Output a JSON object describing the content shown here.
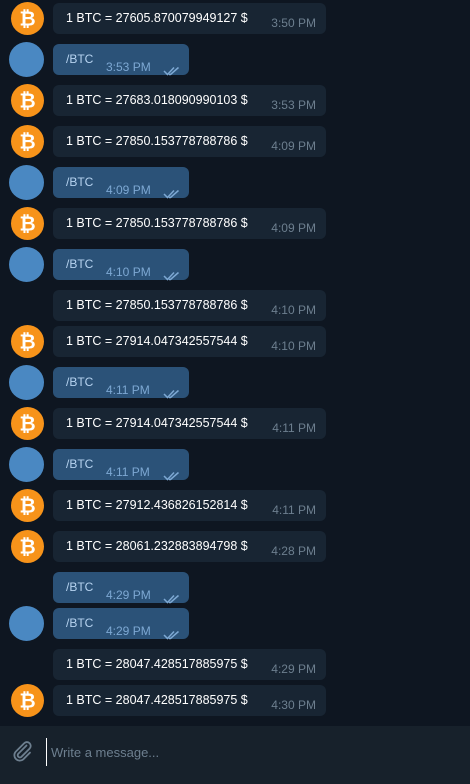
{
  "messages": [
    {
      "side": "in",
      "avatar": true,
      "text": "1 BTC = 27605.870079949127 $",
      "time": "3:50 PM"
    },
    {
      "side": "out",
      "avatar": true,
      "text": "/BTC",
      "time": "3:53 PM"
    },
    {
      "side": "in",
      "avatar": true,
      "text": "1 BTC = 27683.018090990103 $",
      "time": "3:53 PM"
    },
    {
      "side": "in",
      "avatar": true,
      "text": "1 BTC = 27850.153778788786 $",
      "time": "4:09 PM"
    },
    {
      "side": "out",
      "avatar": true,
      "text": "/BTC",
      "time": "4:09 PM"
    },
    {
      "side": "in",
      "avatar": true,
      "text": "1 BTC = 27850.153778788786 $",
      "time": "4:09 PM"
    },
    {
      "side": "out",
      "avatar": true,
      "text": "/BTC",
      "time": "4:10 PM"
    },
    {
      "side": "in",
      "avatar": false,
      "text": "1 BTC = 27850.153778788786 $",
      "time": "4:10 PM"
    },
    {
      "side": "in",
      "avatar": true,
      "text": "1 BTC = 27914.047342557544 $",
      "time": "4:10 PM"
    },
    {
      "side": "out",
      "avatar": true,
      "text": "/BTC",
      "time": "4:11 PM"
    },
    {
      "side": "in",
      "avatar": true,
      "text": "1 BTC = 27914.047342557544 $",
      "time": "4:11 PM"
    },
    {
      "side": "out",
      "avatar": true,
      "text": "/BTC",
      "time": "4:11 PM"
    },
    {
      "side": "in",
      "avatar": true,
      "text": "1 BTC = 27912.436826152814 $",
      "time": "4:11 PM"
    },
    {
      "side": "in",
      "avatar": true,
      "text": "1 BTC = 28061.232883894798 $",
      "time": "4:28 PM"
    },
    {
      "side": "out",
      "avatar": false,
      "text": "/BTC",
      "time": "4:29 PM"
    },
    {
      "side": "out",
      "avatar": true,
      "text": "/BTC",
      "time": "4:29 PM"
    },
    {
      "side": "in",
      "avatar": false,
      "text": "1 BTC = 28047.428517885975 $",
      "time": "4:29 PM"
    },
    {
      "side": "in",
      "avatar": true,
      "text": "1 BTC = 28047.428517885975 $",
      "time": "4:30 PM"
    }
  ],
  "composer": {
    "placeholder": "Write a message...",
    "attach_icon": "paperclip-icon"
  },
  "colors": {
    "background": "#0e1621",
    "incoming_bubble": "#182533",
    "outgoing_bubble": "#2b5278",
    "bitcoin_orange": "#f7931a",
    "user_avatar": "#4a88c2"
  }
}
